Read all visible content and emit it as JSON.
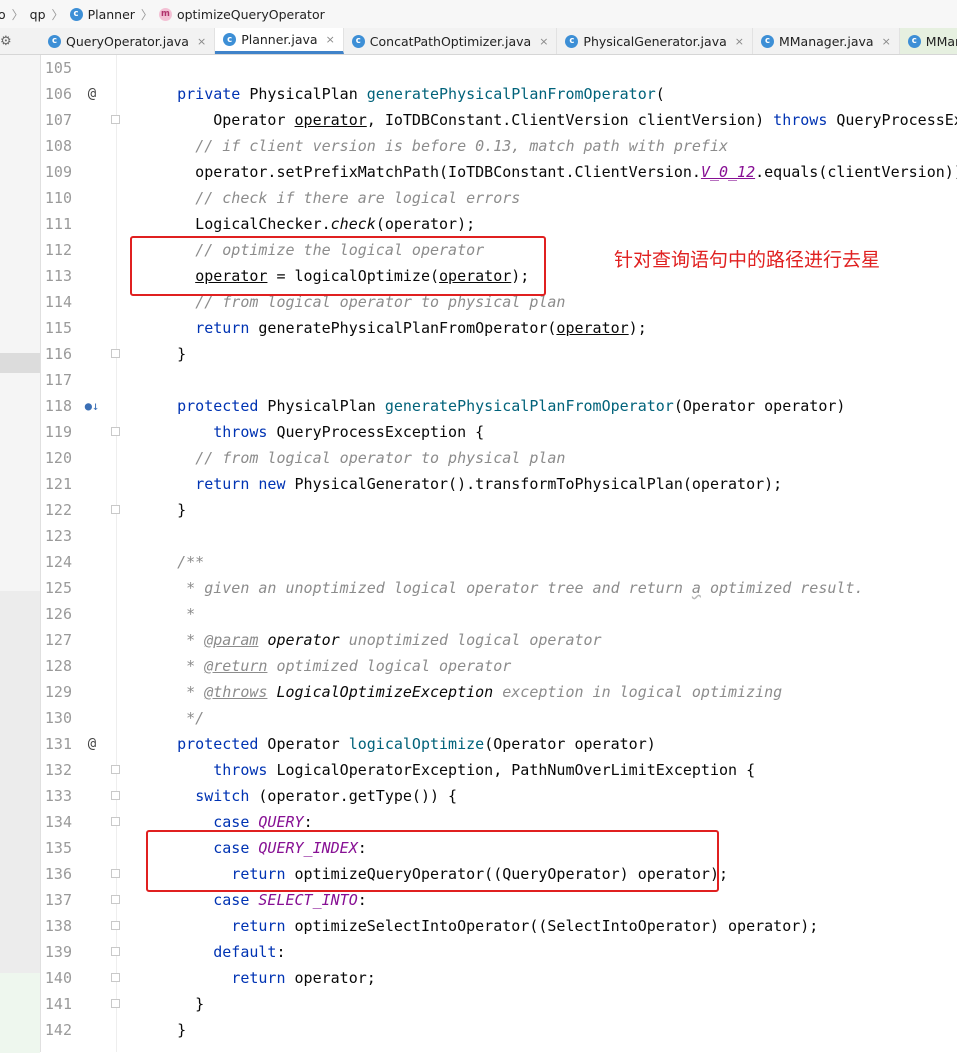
{
  "breadcrumb": [
    {
      "label": "o",
      "icon": null
    },
    {
      "label": "qp",
      "icon": null
    },
    {
      "label": "Planner",
      "icon": "class-icon"
    },
    {
      "label": "optimizeQueryOperator",
      "icon": "method-icon"
    }
  ],
  "tabs": [
    {
      "label": "QueryOperator.java",
      "active": false
    },
    {
      "label": "Planner.java",
      "active": true
    },
    {
      "label": "ConcatPathOptimizer.java",
      "active": false
    },
    {
      "label": "PhysicalGenerator.java",
      "active": false
    },
    {
      "label": "MManager.java",
      "active": false
    },
    {
      "label": "MManagerBas",
      "active": false
    }
  ],
  "annotation_text": "针对查询语句中的路径进行去星",
  "colors": {
    "keyword": "#0033b3",
    "method": "#00627a",
    "comment": "#8c8c8c",
    "constant": "#871094",
    "annotation": "#e02020",
    "active_tab_underline": "#4083c9"
  },
  "lines": [
    {
      "n": "105",
      "tokens": []
    },
    {
      "n": "106",
      "marker": "@",
      "tokens": [
        [
          "    ",
          ""
        ],
        [
          "private",
          "kw"
        ],
        [
          " PhysicalPlan ",
          ""
        ],
        [
          "generatePhysicalPlanFromOperator",
          "fn"
        ],
        [
          "(",
          ""
        ]
      ]
    },
    {
      "n": "107",
      "tokens": [
        [
          "        Operator ",
          ""
        ],
        [
          "operator",
          "ul"
        ],
        [
          ", IoTDBConstant.ClientVersion clientVersion) ",
          ""
        ],
        [
          "throws",
          "kw"
        ],
        [
          " QueryProcessExcept",
          ""
        ]
      ]
    },
    {
      "n": "108",
      "tokens": [
        [
          "      ",
          ""
        ],
        [
          "// if client version is before 0.13, match path with prefix",
          "cm"
        ]
      ]
    },
    {
      "n": "109",
      "tokens": [
        [
          "      operator.setPrefixMatchPath(IoTDBConstant.ClientVersion.",
          ""
        ],
        [
          "V_0_12",
          "cst ul"
        ],
        [
          ".equals(clientVersion));",
          ""
        ]
      ]
    },
    {
      "n": "110",
      "tokens": [
        [
          "      ",
          ""
        ],
        [
          "// check if there are logical errors",
          "cm"
        ]
      ]
    },
    {
      "n": "111",
      "tokens": [
        [
          "      LogicalChecker.",
          ""
        ],
        [
          "check",
          "it"
        ],
        [
          "(operator);",
          ""
        ]
      ]
    },
    {
      "n": "112",
      "tokens": [
        [
          "      ",
          ""
        ],
        [
          "// optimize the logical operator",
          "cm"
        ]
      ]
    },
    {
      "n": "113",
      "tokens": [
        [
          "      ",
          ""
        ],
        [
          "operator",
          "ul"
        ],
        [
          " = logicalOptimize(",
          ""
        ],
        [
          "operator",
          "ul"
        ],
        [
          ");",
          ""
        ]
      ]
    },
    {
      "n": "114",
      "tokens": [
        [
          "      ",
          ""
        ],
        [
          "// from logical operator to physical plan",
          "cm"
        ]
      ]
    },
    {
      "n": "115",
      "tokens": [
        [
          "      ",
          ""
        ],
        [
          "return",
          "kw"
        ],
        [
          " generatePhysicalPlanFromOperator(",
          ""
        ],
        [
          "operator",
          "ul"
        ],
        [
          ");",
          ""
        ]
      ]
    },
    {
      "n": "116",
      "tokens": [
        [
          "    }",
          ""
        ]
      ]
    },
    {
      "n": "117",
      "tokens": []
    },
    {
      "n": "118",
      "marker": "●↓",
      "tokens": [
        [
          "    ",
          ""
        ],
        [
          "protected",
          "kw"
        ],
        [
          " PhysicalPlan ",
          ""
        ],
        [
          "generatePhysicalPlanFromOperator",
          "fn"
        ],
        [
          "(Operator operator)",
          ""
        ]
      ]
    },
    {
      "n": "119",
      "tokens": [
        [
          "        ",
          ""
        ],
        [
          "throws",
          "kw"
        ],
        [
          " QueryProcessException {",
          ""
        ]
      ]
    },
    {
      "n": "120",
      "tokens": [
        [
          "      ",
          ""
        ],
        [
          "// from logical operator to physical plan",
          "cm"
        ]
      ]
    },
    {
      "n": "121",
      "tokens": [
        [
          "      ",
          ""
        ],
        [
          "return",
          "kw"
        ],
        [
          " ",
          ""
        ],
        [
          "new",
          "kw"
        ],
        [
          " PhysicalGenerator().transformToPhysicalPlan(operator);",
          ""
        ]
      ]
    },
    {
      "n": "122",
      "tokens": [
        [
          "    }",
          ""
        ]
      ]
    },
    {
      "n": "123",
      "tokens": []
    },
    {
      "n": "124",
      "tokens": [
        [
          "    ",
          ""
        ],
        [
          "/**",
          "cm"
        ]
      ]
    },
    {
      "n": "125",
      "tokens": [
        [
          "     ",
          ""
        ],
        [
          "* given an unoptimized logical operator tree and return ",
          "cm"
        ],
        [
          "a",
          "cm wv"
        ],
        [
          " optimized result.",
          "cm"
        ]
      ]
    },
    {
      "n": "126",
      "tokens": [
        [
          "     ",
          ""
        ],
        [
          "*",
          "cm"
        ]
      ]
    },
    {
      "n": "127",
      "tokens": [
        [
          "     ",
          ""
        ],
        [
          "* ",
          "cm"
        ],
        [
          "@param",
          "tg"
        ],
        [
          " ",
          "cm"
        ],
        [
          "operator",
          "it"
        ],
        [
          " unoptimized logical operator",
          "cm"
        ]
      ]
    },
    {
      "n": "128",
      "tokens": [
        [
          "     ",
          ""
        ],
        [
          "* ",
          "cm"
        ],
        [
          "@return",
          "tg"
        ],
        [
          " optimized logical operator",
          "cm"
        ]
      ]
    },
    {
      "n": "129",
      "tokens": [
        [
          "     ",
          ""
        ],
        [
          "* ",
          "cm"
        ],
        [
          "@throws",
          "tg"
        ],
        [
          " ",
          "cm"
        ],
        [
          "LogicalOptimizeException",
          "it"
        ],
        [
          " exception in logical optimizing",
          "cm"
        ]
      ]
    },
    {
      "n": "130",
      "tokens": [
        [
          "     ",
          ""
        ],
        [
          "*/",
          "cm"
        ]
      ]
    },
    {
      "n": "131",
      "marker": "@",
      "tokens": [
        [
          "    ",
          ""
        ],
        [
          "protected",
          "kw"
        ],
        [
          " Operator ",
          ""
        ],
        [
          "logicalOptimize",
          "fn"
        ],
        [
          "(Operator operator)",
          ""
        ]
      ]
    },
    {
      "n": "132",
      "tokens": [
        [
          "        ",
          ""
        ],
        [
          "throws",
          "kw"
        ],
        [
          " LogicalOperatorException, PathNumOverLimitException {",
          ""
        ]
      ]
    },
    {
      "n": "133",
      "tokens": [
        [
          "      ",
          ""
        ],
        [
          "switch",
          "kw"
        ],
        [
          " (operator.getType()) {",
          ""
        ]
      ]
    },
    {
      "n": "134",
      "tokens": [
        [
          "        ",
          ""
        ],
        [
          "case",
          "kw"
        ],
        [
          " ",
          ""
        ],
        [
          "QUERY",
          "cst"
        ],
        [
          ":",
          ""
        ]
      ]
    },
    {
      "n": "135",
      "tokens": [
        [
          "        ",
          ""
        ],
        [
          "case",
          "kw"
        ],
        [
          " ",
          ""
        ],
        [
          "QUERY_INDEX",
          "cst"
        ],
        [
          ":",
          ""
        ]
      ]
    },
    {
      "n": "136",
      "tokens": [
        [
          "          ",
          ""
        ],
        [
          "return",
          "kw"
        ],
        [
          " optimizeQueryOperator((QueryOperator) operator);",
          ""
        ]
      ]
    },
    {
      "n": "137",
      "tokens": [
        [
          "        ",
          ""
        ],
        [
          "case",
          "kw"
        ],
        [
          " ",
          ""
        ],
        [
          "SELECT_INTO",
          "cst"
        ],
        [
          ":",
          ""
        ]
      ]
    },
    {
      "n": "138",
      "tokens": [
        [
          "          ",
          ""
        ],
        [
          "return",
          "kw"
        ],
        [
          " optimizeSelectIntoOperator((SelectIntoOperator) operator);",
          ""
        ]
      ]
    },
    {
      "n": "139",
      "tokens": [
        [
          "        ",
          ""
        ],
        [
          "default",
          "kw"
        ],
        [
          ":",
          ""
        ]
      ]
    },
    {
      "n": "140",
      "tokens": [
        [
          "          ",
          ""
        ],
        [
          "return",
          "kw"
        ],
        [
          " operator;",
          ""
        ]
      ]
    },
    {
      "n": "141",
      "tokens": [
        [
          "      }",
          ""
        ]
      ]
    },
    {
      "n": "142",
      "tokens": [
        [
          "    }",
          ""
        ]
      ]
    }
  ]
}
